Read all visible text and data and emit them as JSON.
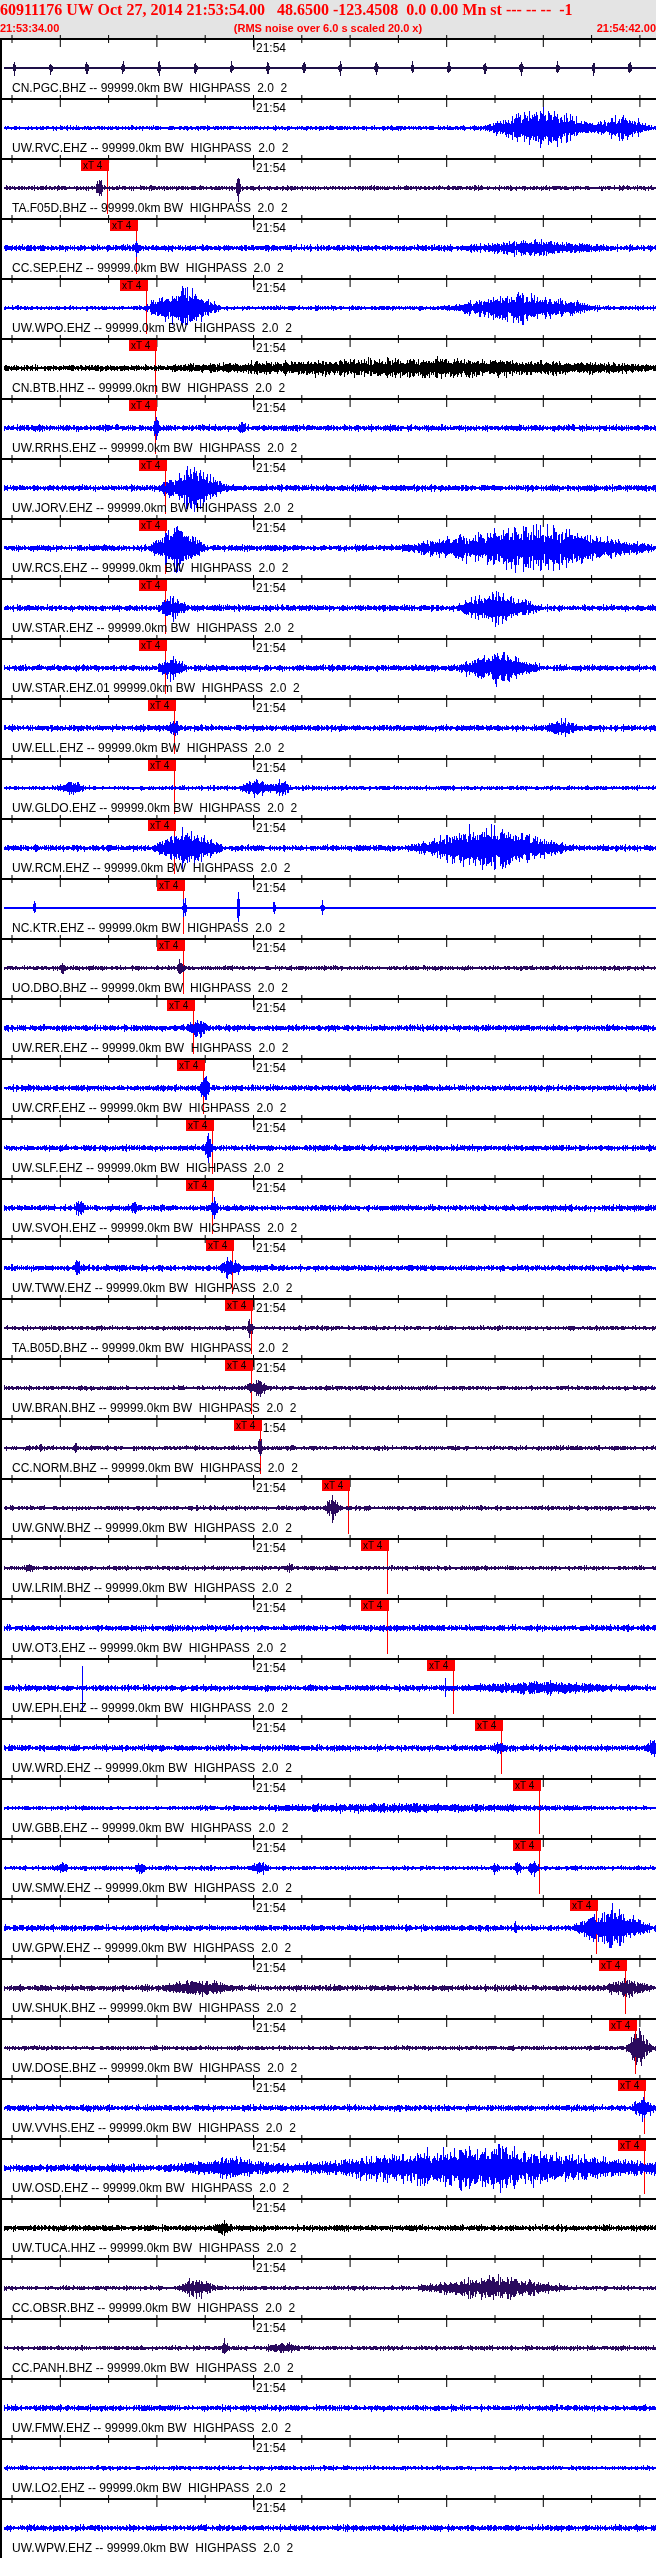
{
  "header": {
    "title": "60911176 UW Oct 27, 2014 21:53:54.00   48.6500 -123.4508  0.0 0.00 Mn st --- -- --  -1",
    "start_time": "21:53:34.00",
    "note": "(RMS noise over 6.0 s scaled 20.0 x)",
    "end_time": "21:54:42.00"
  },
  "traces": [
    {
      "label": "CN.PGC.BHZ -- 99999.0km BW  HIGHPASS  2.0  2",
      "color": "#1e1048",
      "time_mark": "21:54"
    },
    {
      "label": "UW.RVC.EHZ -- 99999.0km BW  HIGHPASS  2.0  2",
      "color": "#0000ff",
      "time_mark": "21:54"
    },
    {
      "label": "TA.F05D.BHZ -- 99999.0km BW  HIGHPASS  2.0  2",
      "color": "#2a0a5e",
      "time_mark": "21:54",
      "pick": {
        "label": "xT 4",
        "level": 0.1616
      }
    },
    {
      "label": "CC.SEP.EHZ -- 99999.0km BW  HIGHPASS  2.0  2",
      "color": "#0000ff",
      "time_mark": "21:54",
      "pick": {
        "label": "xT 4",
        "level": 0.2058
      }
    },
    {
      "label": "UW.WPO.EHZ -- 99999.0km BW  HIGHPASS  2.0  2",
      "color": "#0000ff",
      "time_mark": "21:54",
      "pick": {
        "label": "xT 4",
        "level": 0.221
      }
    },
    {
      "label": "CN.BTB.HHZ -- 99999.0km BW  HIGHPASS  2.0  2",
      "color": "#000000",
      "time_mark": "21:54",
      "pick": {
        "label": "xT 4",
        "level": 0.2348
      }
    },
    {
      "label": "UW.RRHS.EHZ -- 99999.0km BW  HIGHPASS  2.0  2",
      "color": "#0000ff",
      "time_mark": "21:54",
      "pick": {
        "label": "xT 4",
        "level": 0.2348
      }
    },
    {
      "label": "UW.JORV.EHZ -- 99999.0km BW  HIGHPASS  2.0  2",
      "color": "#0000ff",
      "time_mark": "21:54",
      "pick": {
        "label": "xT 4",
        "level": 0.25
      }
    },
    {
      "label": "UW.RCS.EHZ -- 99999.0km BW  HIGHPASS  2.0  2",
      "color": "#0000ff",
      "time_mark": "21:54",
      "pick": {
        "label": "xT 4",
        "level": 0.25
      }
    },
    {
      "label": "UW.STAR.EHZ -- 99999.0km BW  HIGHPASS  2.0  2",
      "color": "#0000ff",
      "time_mark": "21:54",
      "pick": {
        "label": "xT 4",
        "level": 0.25
      }
    },
    {
      "label": "UW.STAR.EHZ.01 99999.0km BW  HIGHPASS  2.0  2",
      "color": "#0000ff",
      "time_mark": "21:54",
      "pick": {
        "label": "xT 4",
        "level": 0.25
      }
    },
    {
      "label": "UW.ELL.EHZ -- 99999.0km BW  HIGHPASS  2.0  2",
      "color": "#0000ff",
      "time_mark": "21:54",
      "pick": {
        "label": "xT 4",
        "level": 0.2652
      }
    },
    {
      "label": "UW.GLDO.EHZ -- 99999.0km BW  HIGHPASS  2.0  2",
      "color": "#0000ff",
      "time_mark": "21:54",
      "pick": {
        "label": "xT 4",
        "level": 0.2652
      }
    },
    {
      "label": "UW.RCM.EHZ -- 99999.0km BW  HIGHPASS  2.0  2",
      "color": "#0000ff",
      "time_mark": "21:54",
      "pick": {
        "label": "xT 4",
        "level": 0.2652
      }
    },
    {
      "label": "NC.KTR.EHZ -- 99999.0km BW  HIGHPASS  2.0  2",
      "color": "#0000ff",
      "time_mark": "21:54",
      "pick": {
        "label": "xT 4",
        "level": 0.279
      }
    },
    {
      "label": "UO.DBO.BHZ -- 99999.0km BW  HIGHPASS  2.0  2",
      "color": "#2a0a5e",
      "time_mark": "21:54",
      "pick": {
        "label": "xT 4",
        "level": 0.279
      }
    },
    {
      "label": "UW.RER.EHZ -- 99999.0km BW  HIGHPASS  2.0  2",
      "color": "#0000ff",
      "time_mark": "21:54",
      "pick": {
        "label": "xT 4",
        "level": 0.2942
      }
    },
    {
      "label": "UW.CRF.EHZ -- 99999.0km BW  HIGHPASS  2.0  2",
      "color": "#0000ff",
      "time_mark": "21:54",
      "pick": {
        "label": "xT 4",
        "level": 0.3095
      }
    },
    {
      "label": "UW.SLF.EHZ -- 99999.0km BW  HIGHPASS  2.0  2",
      "color": "#0000ff",
      "time_mark": "21:54",
      "pick": {
        "label": "xT 4",
        "level": 0.3232
      }
    },
    {
      "label": "UW.SVOH.EHZ -- 99999.0km BW  HIGHPASS  2.0  2",
      "color": "#0000ff",
      "time_mark": "21:54",
      "pick": {
        "label": "xT 4",
        "level": 0.3232
      }
    },
    {
      "label": "UW.TWW.EHZ -- 99999.0km BW  HIGHPASS  2.0  2",
      "color": "#0000ff",
      "time_mark": "21:54",
      "pick": {
        "label": "xT 4",
        "level": 0.3537
      }
    },
    {
      "label": "TA.B05D.BHZ -- 99999.0km BW  HIGHPASS  2.0  2",
      "color": "#2a0a5e",
      "time_mark": "21:54",
      "pick": {
        "label": "xT 4",
        "level": 0.3826
      }
    },
    {
      "label": "UW.BRAN.BHZ -- 99999.0km BW  HIGHPASS  2.0  2",
      "color": "#2a0a5e",
      "time_mark": "21:54",
      "pick": {
        "label": "xT 4",
        "level": 0.3826
      }
    },
    {
      "label": "CC.NORM.BHZ -- 99999.0km BW  HIGHPASS  2.0  2",
      "color": "#2a0a5e",
      "time_mark": "1:54",
      "pick": {
        "label": "xT 4",
        "level": 0.396
      }
    },
    {
      "label": "UW.GNW.BHZ -- 99999.0km BW  HIGHPASS  2.0  2",
      "color": "#2a0a5e",
      "time_mark": "21:54",
      "pick": {
        "label": "xT 4",
        "level": 0.5306
      }
    },
    {
      "label": "UW.LRIM.BHZ -- 99999.0km BW  HIGHPASS  2.0  2",
      "color": "#2a0a5e",
      "time_mark": "21:54",
      "pick": {
        "label": "xT 4",
        "level": 0.5902
      }
    },
    {
      "label": "UW.OT3.EHZ -- 99999.0km BW  HIGHPASS  2.0  2",
      "color": "#0000ff",
      "time_mark": "21:54",
      "pick": {
        "label": "xT 4",
        "level": 0.5902
      }
    },
    {
      "label": "UW.EPH.EHZ -- 99999.0km BW  HIGHPASS  2.0  2",
      "color": "#0000ff",
      "time_mark": "21:54",
      "pick": {
        "label": "xT 4",
        "level": 0.6911
      }
    },
    {
      "label": "UW.WRD.EHZ -- 99999.0km BW  HIGHPASS  2.0  2",
      "color": "#0000ff",
      "time_mark": "21:54",
      "pick": {
        "label": "xT 4",
        "level": 0.7645
      }
    },
    {
      "label": "UW.GBB.EHZ -- 99999.0km BW  HIGHPASS  2.0  2",
      "color": "#0000ff",
      "time_mark": "21:54",
      "pick": {
        "label": "xT 4",
        "level": 0.8226
      }
    },
    {
      "label": "UW.SMW.EHZ -- 99999.0km BW  HIGHPASS  2.0  2",
      "color": "#0000ff",
      "time_mark": "21:54",
      "pick": {
        "label": "xT 4",
        "level": 0.8226
      }
    },
    {
      "label": "UW.GPW.EHZ -- 99999.0km BW  HIGHPASS  2.0  2",
      "color": "#0000ff",
      "time_mark": "21:54",
      "pick": {
        "label": "xT 4",
        "level": 0.9098
      }
    },
    {
      "label": "UW.SHUK.BHZ -- 99999.0km BW  HIGHPASS  2.0  2",
      "color": "#2a0a5e",
      "time_mark": "21:54",
      "pick": {
        "label": "xT 4",
        "level": 0.9541
      }
    },
    {
      "label": "UW.DOSE.BHZ -- 99999.0km BW  HIGHPASS  2.0  2",
      "color": "#2a0a5e",
      "time_mark": "21:54",
      "pick": {
        "label": "xT 4",
        "level": 0.9694
      }
    },
    {
      "label": "UW.VVHS.EHZ -- 99999.0km BW  HIGHPASS  2.0  2",
      "color": "#0000ff",
      "time_mark": "21:54",
      "pick": {
        "label": "xT 4",
        "level": 0.9832
      }
    },
    {
      "label": "UW.OSD.EHZ -- 99999.0km BW  HIGHPASS  2.0  2",
      "color": "#0000ff",
      "time_mark": "21:54",
      "pick": {
        "label": "xT 4",
        "level": 0.9832
      }
    },
    {
      "label": "UW.TUCA.HHZ -- 99999.0km BW  HIGHPASS  2.0  2",
      "color": "#000000",
      "time_mark": "21:54"
    },
    {
      "label": "CC.OBSR.BHZ -- 99999.0km BW  HIGHPASS  2.0  2",
      "color": "#2a0a5e",
      "time_mark": "21:54"
    },
    {
      "label": "CC.PANH.BHZ -- 99999.0km BW  HIGHPASS  2.0  2",
      "color": "#2a0a5e",
      "time_mark": "21:54"
    },
    {
      "label": "UW.FMW.EHZ -- 99999.0km BW  HIGHPASS  2.0  2",
      "color": "#0000ff",
      "time_mark": "21:54"
    },
    {
      "label": "UW.LO2.EHZ -- 99999.0km BW  HIGHPASS  2.0  2",
      "color": "#0000ff",
      "time_mark": "21:54"
    },
    {
      "label": "UW.WPW.EHZ -- 99999.0km BW  HIGHPASS  2.0  2",
      "color": "#0000ff",
      "time_mark": "21:54"
    }
  ]
}
